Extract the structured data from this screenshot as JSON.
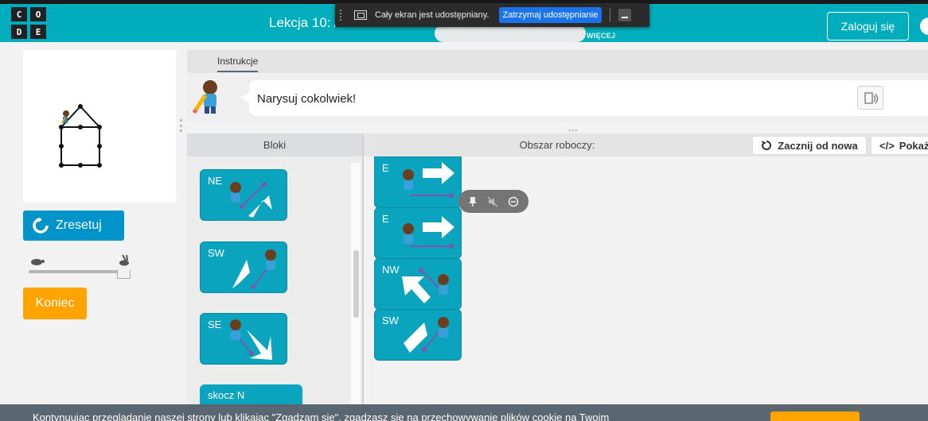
{
  "header": {
    "logo_letters": [
      "C",
      "O",
      "D",
      "E"
    ],
    "lesson_title": "Lekcja 10: A",
    "more_label": "WIĘCEJ",
    "login_label": "Zaloguj się",
    "brand_color": "#00adbc"
  },
  "share_bar": {
    "text": "Cały ekran jest udostępniany.",
    "stop_label": "Zatrzymaj udostępnianie"
  },
  "left_panel": {
    "reset_label": "Zresetuj",
    "finish_label": "Koniec",
    "speed_slider_value": 1.0
  },
  "instructions": {
    "tab_label": "Instrukcje",
    "text": "Narysuj cokolwiek!"
  },
  "workspace": {
    "blocks_label": "Bloki",
    "workspace_label": "Obszar roboczy:",
    "restart_label": "Zacznij od nowa",
    "code_label": "Pokaż"
  },
  "toolbox_blocks": [
    {
      "label": "NE"
    },
    {
      "label": "SW"
    },
    {
      "label": "SE"
    },
    {
      "label": "skocz N"
    }
  ],
  "program_blocks": [
    {
      "label": "E"
    },
    {
      "label": "E"
    },
    {
      "label": "NW"
    },
    {
      "label": "SW"
    }
  ],
  "cookie": {
    "text": "Kontynuując przeglądanie naszej strony lub klikając \"Zgadzam się\", zgadzasz się na przechowywanie plików cookie na Twoim"
  }
}
